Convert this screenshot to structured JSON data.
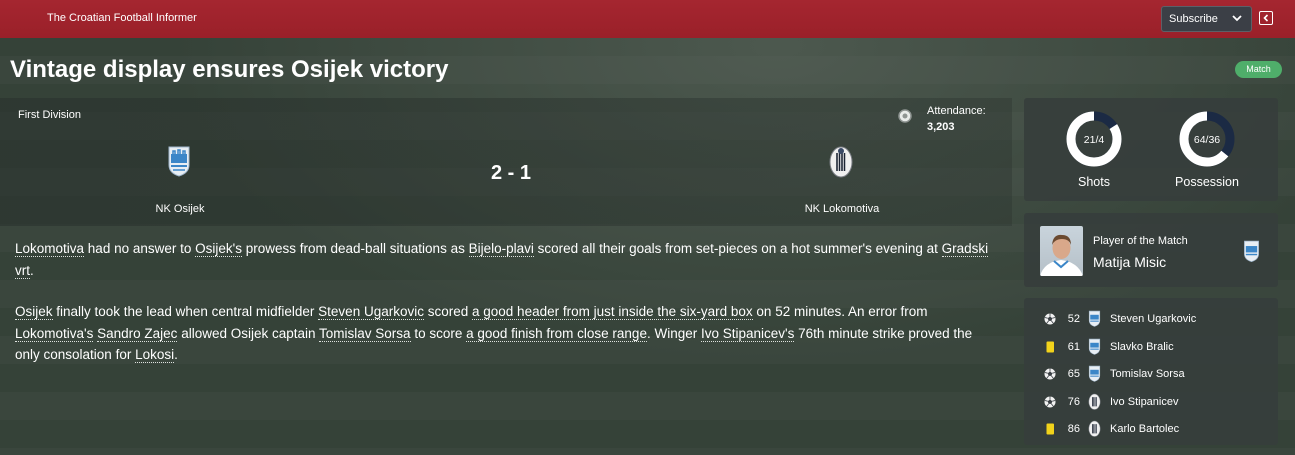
{
  "header": {
    "publisher": "The Croatian Football Informer",
    "subscribe_label": "Subscribe"
  },
  "article": {
    "headline": "Vintage display ensures Osijek victory",
    "tag": "Match",
    "paragraph1": [
      {
        "t": "Lokomotiva",
        "link": true
      },
      {
        "t": " had no answer to ",
        "link": false
      },
      {
        "t": "Osijek's",
        "link": true
      },
      {
        "t": " prowess from dead-ball situations as ",
        "link": false
      },
      {
        "t": "Bijelo-plavi",
        "link": true
      },
      {
        "t": " scored all their goals from set-pieces on a hot summer's evening at ",
        "link": false
      },
      {
        "t": "Gradski vrt",
        "link": true
      },
      {
        "t": ".",
        "link": false
      }
    ],
    "paragraph2": [
      {
        "t": "Osijek",
        "link": true
      },
      {
        "t": " finally took the lead when central midfielder ",
        "link": false
      },
      {
        "t": "Steven Ugarkovic",
        "link": true
      },
      {
        "t": " scored ",
        "link": false
      },
      {
        "t": "a good header from just inside the six-yard box",
        "link": true
      },
      {
        "t": " on 52 minutes. An error from ",
        "link": false
      },
      {
        "t": "Lokomotiva's",
        "link": true
      },
      {
        "t": " ",
        "link": false
      },
      {
        "t": "Sandro Zajec",
        "link": true
      },
      {
        "t": " allowed Osijek captain ",
        "link": false
      },
      {
        "t": "Tomislav Sorsa",
        "link": true
      },
      {
        "t": " to score ",
        "link": false
      },
      {
        "t": "a good finish from close range",
        "link": true
      },
      {
        "t": ". Winger ",
        "link": false
      },
      {
        "t": "Ivo Stipanicev's",
        "link": true
      },
      {
        "t": " 76th minute strike proved the only consolation for ",
        "link": false
      },
      {
        "t": "Lokosi",
        "link": true
      },
      {
        "t": ".",
        "link": false
      }
    ]
  },
  "match": {
    "competition": "First Division",
    "attendance_label": "Attendance:",
    "attendance_value": "3,203",
    "home_team": "NK Osijek",
    "away_team": "NK Lokomotiva",
    "score": "2 - 1"
  },
  "stats": {
    "shots": {
      "label": "21/4",
      "caption": "Shots",
      "home": 21,
      "away": 4
    },
    "possession": {
      "label": "64/36",
      "caption": "Possession",
      "home": 64,
      "away": 36
    }
  },
  "player_of_match": {
    "label": "Player of the Match",
    "name": "Matija Misic"
  },
  "events": [
    {
      "type": "goal",
      "minute": "52",
      "team": "home",
      "player": "Steven Ugarkovic"
    },
    {
      "type": "yellow-card",
      "minute": "61",
      "team": "home",
      "player": "Slavko Bralic"
    },
    {
      "type": "goal",
      "minute": "65",
      "team": "home",
      "player": "Tomislav Sorsa"
    },
    {
      "type": "goal",
      "minute": "76",
      "team": "away",
      "player": "Ivo Stipanicev"
    },
    {
      "type": "yellow-card",
      "minute": "86",
      "team": "away",
      "player": "Karlo Bartolec"
    }
  ],
  "colors": {
    "header_red": "#a52630",
    "match_tag": "#4fae6a",
    "donut_home": "#ffffff",
    "donut_away": "#1b2a44",
    "yellow_card": "#f2d31b"
  }
}
